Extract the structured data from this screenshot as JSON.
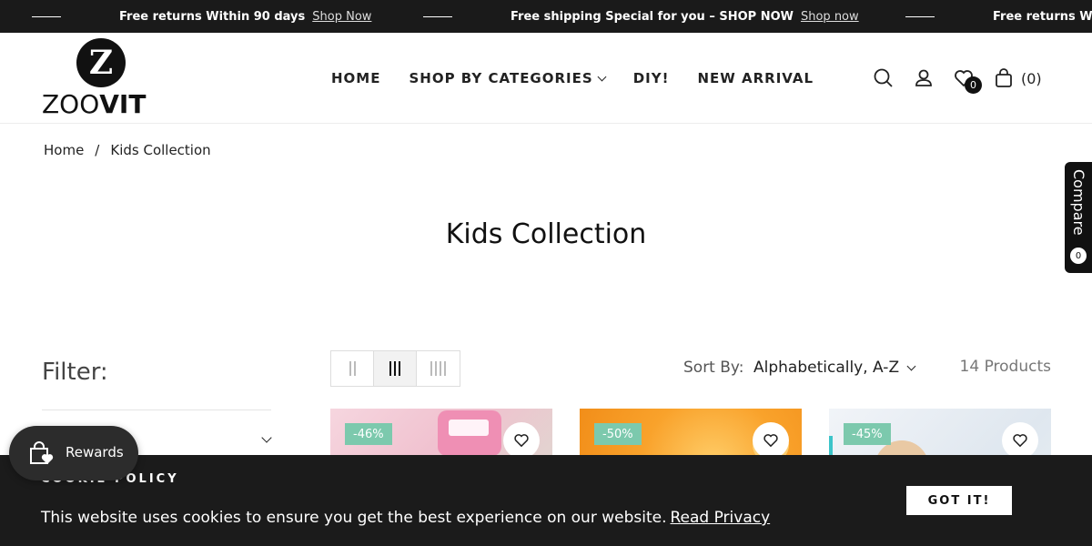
{
  "announcement": {
    "items": [
      {
        "text": "Free returns Within 90 days",
        "link": "Shop Now"
      },
      {
        "text": "Free shipping Special for you – SHOP NOW",
        "link": "Shop now"
      },
      {
        "text": "Free returns Wit",
        "link": ""
      }
    ]
  },
  "header": {
    "logo_letter": "Z",
    "logo_text_light": "ZOO",
    "logo_text_bold": "VIT",
    "nav": [
      "HOME",
      "SHOP BY CATEGORIES",
      "DIY!",
      "NEW ARRIVAL"
    ],
    "wishlist_count": "0",
    "cart_count": "(0)"
  },
  "breadcrumb": {
    "home": "Home",
    "separator": "/",
    "current": "Kids Collection"
  },
  "page_title": "Kids Collection",
  "compare": {
    "label": "Compare",
    "count": "0"
  },
  "filter": {
    "title": "Filter:"
  },
  "toolbar": {
    "sort_label": "Sort By:",
    "sort_value": "Alphabetically, A-Z",
    "product_count": "14 Products",
    "grid_columns": [
      2,
      3,
      4
    ],
    "active_grid": 3
  },
  "products": [
    {
      "badge": "-46%"
    },
    {
      "badge": "-50%"
    },
    {
      "badge": "-45%"
    }
  ],
  "cookie": {
    "title": "COOKIE POLICY",
    "text": "This website uses cookies to ensure you get the best experience on our website.",
    "link": "Read Privacy",
    "button": "GOT IT!"
  },
  "rewards": {
    "label": "Rewards"
  },
  "colors": {
    "dark": "#1a1a1a",
    "badge": "#7cc9ad"
  }
}
